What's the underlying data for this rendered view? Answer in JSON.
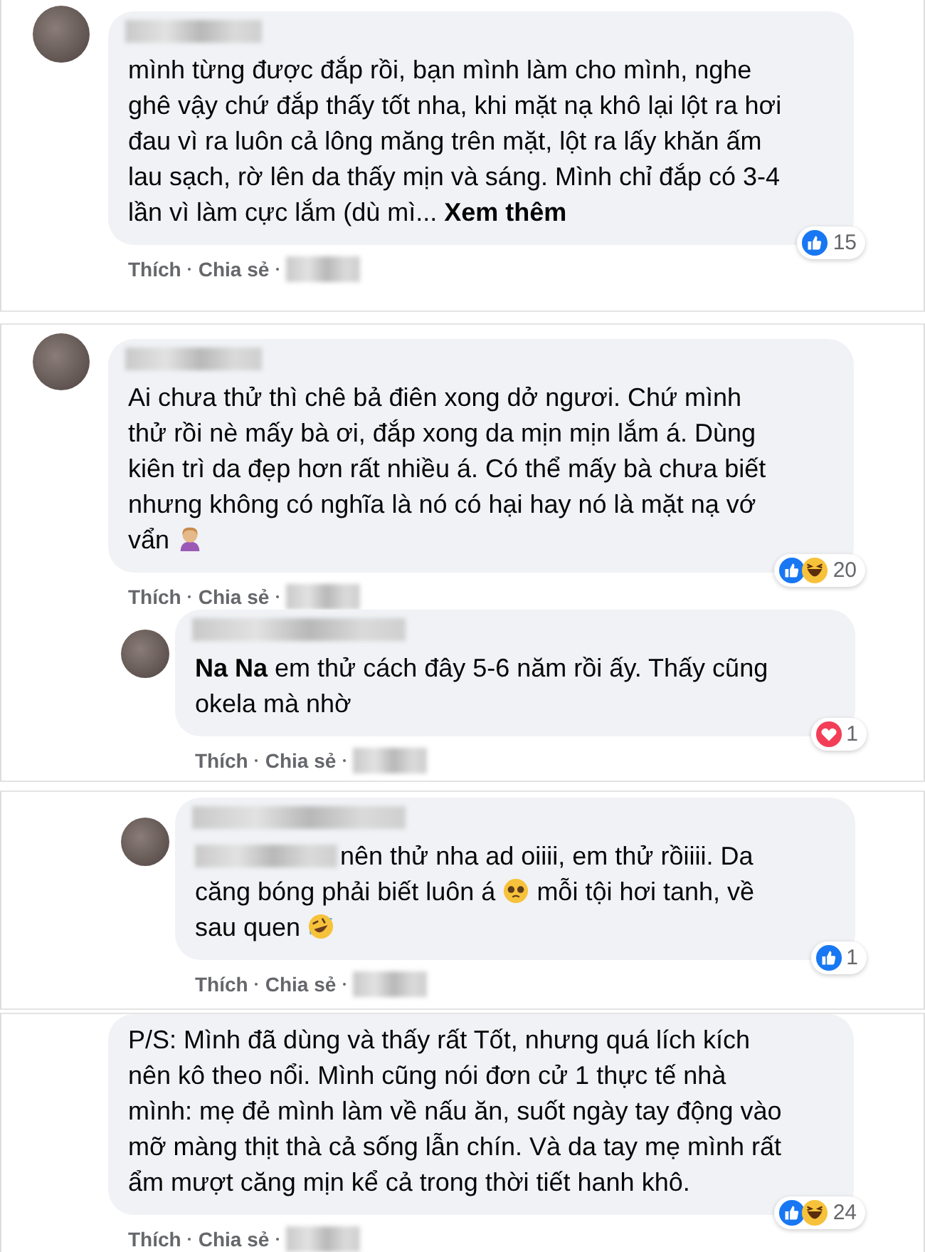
{
  "panels": [
    {
      "items": [
        {
          "kind": "comment",
          "avatar": true,
          "segments": [
            {
              "kind": "text",
              "text": "mình từng được đắp rồi, bạn mình làm cho mình, nghe ghê vậy chứ đắp thấy tốt nha, khi mặt nạ khô lại lột ra hơi đau vì ra luôn cả lông măng trên mặt, lột ra lấy khăn ấm lau sạch, rờ lên da thấy mịn và sáng. Mình chỉ đắp có 3-4 lần vì làm cực lắm (dù mì... "
            },
            {
              "kind": "link",
              "text": "Xem thêm"
            }
          ],
          "reactions": [
            {
              "kind": "like"
            }
          ],
          "count": "15",
          "actions": [
            "Thích",
            "Chia sẻ"
          ]
        }
      ]
    },
    {
      "items": [
        {
          "kind": "comment",
          "avatar": true,
          "segments": [
            {
              "kind": "text",
              "text": "Ai chưa thử thì chê bả điên xong dở ngươi. Chứ mình thử rồi nè mấy bà ơi, đắp xong da mịn mịn lắm á. Dùng kiên trì da đẹp hơn rất nhiều á. Có thể mấy bà chưa biết nhưng không có nghĩa là nó có hại hay nó là mặt nạ vớ vẩn "
            },
            {
              "kind": "tipping"
            }
          ],
          "reactions": [
            {
              "kind": "like"
            },
            {
              "kind": "haha"
            }
          ],
          "count": "20",
          "actions": [
            "Thích",
            "Chia sẻ"
          ]
        },
        {
          "kind": "reply",
          "avatar": true,
          "segments": [
            {
              "kind": "mention",
              "text": "Na Na"
            },
            {
              "kind": "text",
              "text": " em thử cách đây 5-6 năm rồi ấy. Thấy cũng okela mà nhờ"
            }
          ],
          "reactions": [
            {
              "kind": "love"
            }
          ],
          "count": "1",
          "actions": [
            "Thích",
            "Chia sẻ"
          ]
        }
      ]
    },
    {
      "items": [
        {
          "kind": "reply",
          "avatar": true,
          "segments": [
            {
              "kind": "redacted"
            },
            {
              "kind": "text",
              "text": "nên thử nha ad oiiii, em thử rồiiii. Da căng bóng phải biết luôn á "
            },
            {
              "kind": "pleading"
            },
            {
              "kind": "text",
              "text": " mỗi tội hơi tanh, về sau quen "
            },
            {
              "kind": "rofl"
            }
          ],
          "reactions": [
            {
              "kind": "like"
            }
          ],
          "count": "1",
          "actions": [
            "Thích",
            "Chia sẻ"
          ]
        }
      ]
    },
    {
      "items": [
        {
          "kind": "comment",
          "avatar": false,
          "segments": [
            {
              "kind": "text",
              "text": "P/S: Mình đã dùng và thấy rất Tốt, nhưng quá lích kích nên kô theo nổi. Mình cũng nói đơn cử 1 thực tế nhà mình: mẹ đẻ mình làm về nấu ăn, suốt ngày tay động vào mỡ màng thịt thà cả sống lẫn chín. Và da tay mẹ mình rất ẩm mượt căng mịn kể cả trong thời tiết hanh khô."
            }
          ],
          "reactions": [
            {
              "kind": "like"
            },
            {
              "kind": "haha"
            }
          ],
          "count": "24",
          "actions": [
            "Thích",
            "Chia sẻ"
          ]
        }
      ]
    }
  ]
}
